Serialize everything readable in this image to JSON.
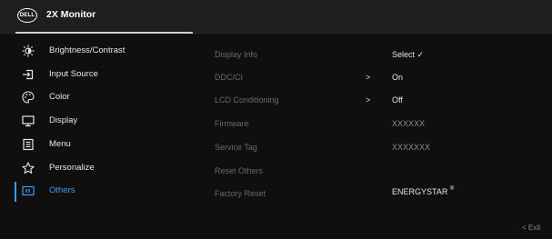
{
  "header": {
    "logo_text": "DELL",
    "title": "2X Monitor"
  },
  "menu": [
    {
      "label": "Brightness/Contrast",
      "icon": "brightness-icon"
    },
    {
      "label": "Input Source",
      "icon": "input-source-icon"
    },
    {
      "label": "Color",
      "icon": "color-palette-icon"
    },
    {
      "label": "Display",
      "icon": "display-monitor-icon"
    },
    {
      "label": "Menu",
      "icon": "menu-list-icon"
    },
    {
      "label": "Personalize",
      "icon": "star-icon"
    },
    {
      "label": "Others",
      "icon": "others-info-icon",
      "active": true
    }
  ],
  "submenu": [
    {
      "label": "Display Info",
      "arrow": "",
      "value": "Select ✓"
    },
    {
      "label": "DDC/CI",
      "arrow": ">",
      "value": "On"
    },
    {
      "label": "LCD Conditioning",
      "arrow": ">",
      "value": "Off"
    },
    {
      "label": "Firmware",
      "arrow": "",
      "value": "XXXXXX"
    },
    {
      "label": "Service Tag",
      "arrow": "",
      "value": "XXXXXXX"
    },
    {
      "label": "Reset Others",
      "arrow": "",
      "value": ""
    },
    {
      "label": "Factory Reset",
      "arrow": "",
      "value": "ENERGYSTAR",
      "value_sup": "®"
    }
  ],
  "footer": {
    "exit_label": "<  Exit"
  },
  "colors": {
    "accent": "#3d9df0",
    "background": "#0f0f0f",
    "header": "#1e1e1e"
  }
}
